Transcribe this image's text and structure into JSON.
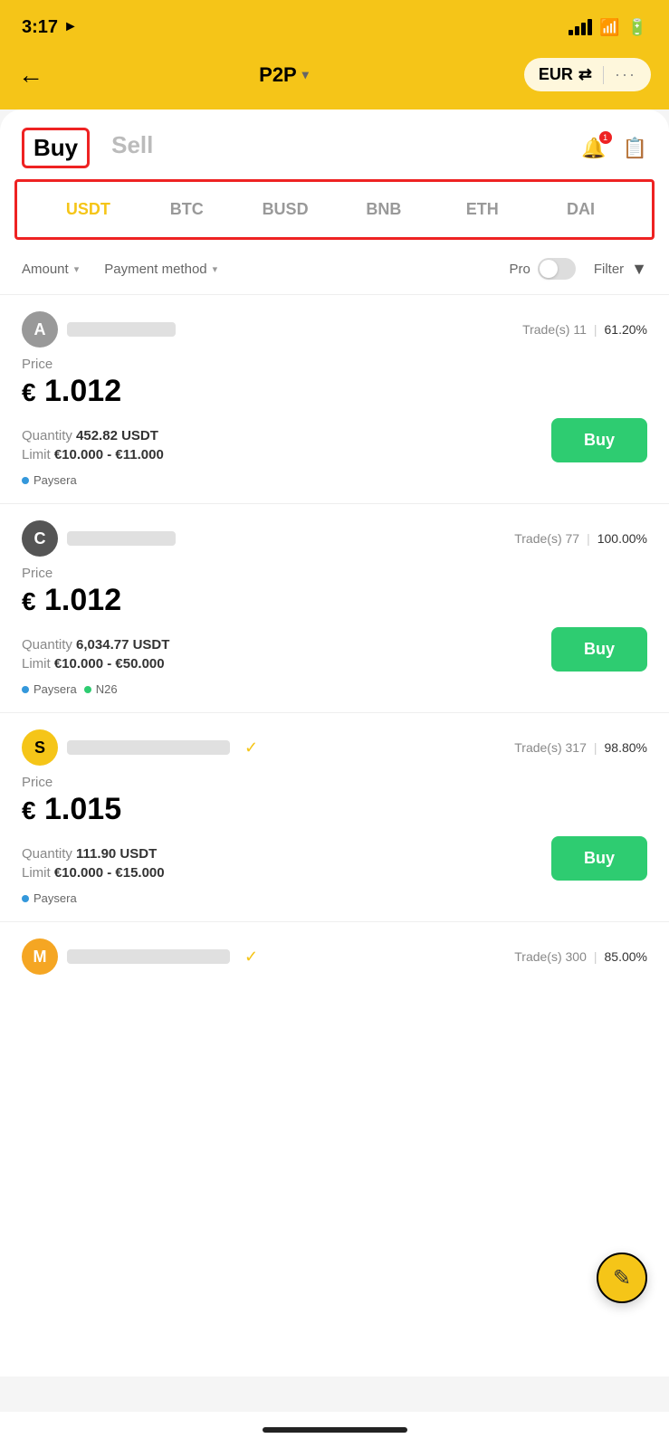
{
  "statusBar": {
    "time": "3:17",
    "locationIcon": "▶"
  },
  "header": {
    "backLabel": "←",
    "title": "P2P",
    "titleChevron": "▾",
    "currency": "EUR",
    "currencyIcon": "⇄",
    "moreLabel": "···"
  },
  "tabs": {
    "buy": "Buy",
    "sell": "Sell",
    "activeTab": "buy"
  },
  "cryptoTabs": {
    "items": [
      "USDT",
      "BTC",
      "BUSD",
      "BNB",
      "ETH",
      "DAI"
    ],
    "activeItem": "USDT"
  },
  "filters": {
    "amount": "Amount",
    "paymentMethod": "Payment method",
    "pro": "Pro",
    "filter": "Filter"
  },
  "listings": [
    {
      "avatarLetter": "A",
      "avatarColor": "gray",
      "trades": "Trade(s) 11",
      "percent": "61.20%",
      "priceLabel": "Price",
      "priceCurrency": "€",
      "priceValue": "1.012",
      "quantityLabel": "Quantity",
      "quantityValue": "452.82 USDT",
      "limitLabel": "Limit",
      "limitValue": "€10.000 - €11.000",
      "buyLabel": "Buy",
      "paymentTags": [
        {
          "name": "Paysera",
          "dotColor": "dot-blue"
        }
      ],
      "verified": false
    },
    {
      "avatarLetter": "C",
      "avatarColor": "dark-gray",
      "trades": "Trade(s) 77",
      "percent": "100.00%",
      "priceLabel": "Price",
      "priceCurrency": "€",
      "priceValue": "1.012",
      "quantityLabel": "Quantity",
      "quantityValue": "6,034.77 USDT",
      "limitLabel": "Limit",
      "limitValue": "€10.000 - €50.000",
      "buyLabel": "Buy",
      "paymentTags": [
        {
          "name": "Paysera",
          "dotColor": "dot-blue"
        },
        {
          "name": "N26",
          "dotColor": "dot-green"
        }
      ],
      "verified": false
    },
    {
      "avatarLetter": "S",
      "avatarColor": "gold",
      "trades": "Trade(s) 317",
      "percent": "98.80%",
      "priceLabel": "Price",
      "priceCurrency": "€",
      "priceValue": "1.015",
      "quantityLabel": "Quantity",
      "quantityValue": "111.90 USDT",
      "limitLabel": "Limit",
      "limitValue": "€10.000 - €15.000",
      "buyLabel": "Buy",
      "paymentTags": [
        {
          "name": "Paysera",
          "dotColor": "dot-blue"
        }
      ],
      "verified": true
    }
  ],
  "partialListing": {
    "avatarLetter": "M",
    "avatarColor": "orange",
    "trades": "Trade(s) 300",
    "percent": "85.00%",
    "verified": true
  },
  "fab": {
    "icon": "✎"
  }
}
